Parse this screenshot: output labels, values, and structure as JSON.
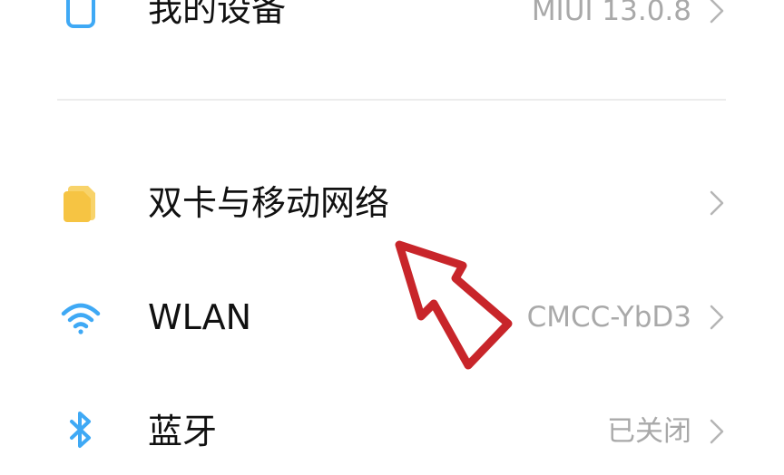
{
  "settings": {
    "my_device": {
      "label": "我的设备",
      "value": "MIUI 13.0.8",
      "icon": "phone-outline-icon"
    },
    "dual_sim": {
      "label": "双卡与移动网络",
      "icon": "sim-card-icon",
      "icon_color": "#f6c443"
    },
    "wlan": {
      "label": "WLAN",
      "value": "CMCC-YbD3",
      "icon": "wifi-icon",
      "icon_color": "#3fa9f5"
    },
    "bluetooth": {
      "label": "蓝牙",
      "value": "已关闭",
      "icon": "bluetooth-icon",
      "icon_color": "#3fa9f5"
    }
  },
  "annotation": {
    "icon": "hand-drawn-arrow-icon",
    "color": "#c8252a"
  }
}
